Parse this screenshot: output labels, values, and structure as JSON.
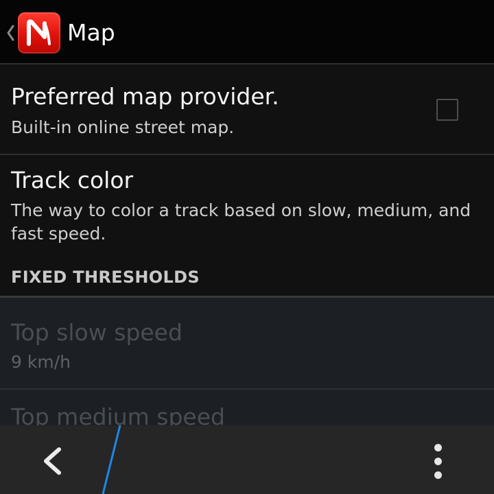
{
  "action_bar": {
    "title": "Map",
    "app_icon": "app-logo-n-icon",
    "up_icon": "chevron-left-icon"
  },
  "preferences": [
    {
      "title": "Preferred map provider.",
      "summary": "Built-in online street map.",
      "checked": false
    },
    {
      "title": "Track color",
      "summary": "The way to color a track based on slow, medium, and fast speed."
    }
  ],
  "category": {
    "label": "FIXED THRESHOLDS"
  },
  "threshold_prefs": [
    {
      "title": "Top slow speed",
      "summary": "9 km/h",
      "enabled": false
    },
    {
      "title": "Top medium speed",
      "summary": "",
      "enabled": false
    }
  ],
  "bottom_bar": {
    "back_icon": "back-arrow-icon",
    "overflow_icon": "overflow-menu-icon"
  },
  "colors": {
    "accent_line": "#1e88e5",
    "app_icon_red": "#e0120b"
  }
}
